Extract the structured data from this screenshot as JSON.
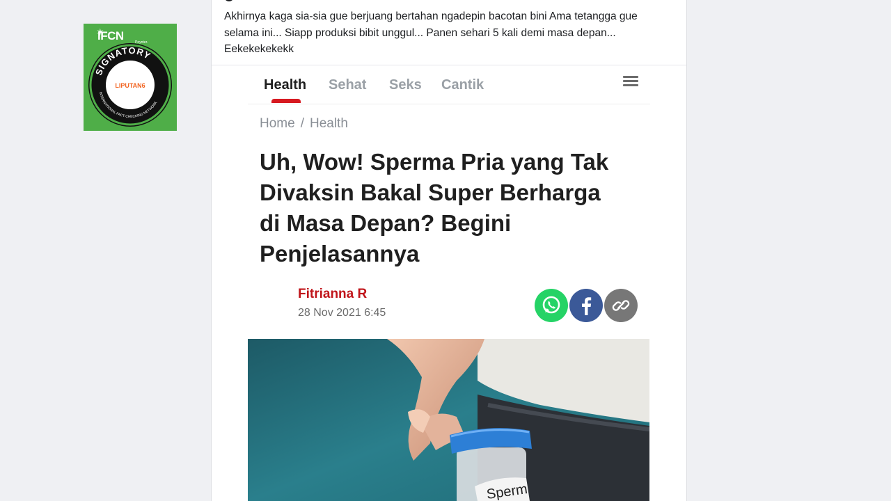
{
  "badge": {
    "ifcn_text": "IFCN",
    "poynter_text": "Poynter.",
    "ring_text": "SIGNATORY",
    "ring_bottom_text": "INTERNATIONAL FACT-CHECKING NETWORK",
    "center_text": "LIPUTAN6"
  },
  "post": {
    "text": "Akhirnya kaga sia-sia gue berjuang bertahan ngadepin bacotan bini Ama tetangga gue selama ini... Siapp produksi bibit unggul... Panen sehari 5 kali demi masa depan... Eekekekekekk"
  },
  "article": {
    "nav": [
      "Health",
      "Sehat",
      "Seks",
      "Cantik"
    ],
    "breadcrumb": {
      "home": "Home",
      "sep": "/",
      "current": "Health"
    },
    "headline": "Uh, Wow! Sperma Pria yang Tak Divaksin Bakal Super Berharga di Masa Depan? Begini Penjelasannya",
    "author": "Fitrianna R",
    "date": "28 Nov 2021 6:45",
    "share_icons": [
      "whatsapp-icon",
      "facebook-icon",
      "link-icon"
    ],
    "image_label": "Sperm",
    "colors": {
      "accent": "#d71920",
      "author": "#c0141a",
      "whatsapp": "#25d366",
      "facebook": "#3b5998",
      "link": "#777777"
    }
  }
}
